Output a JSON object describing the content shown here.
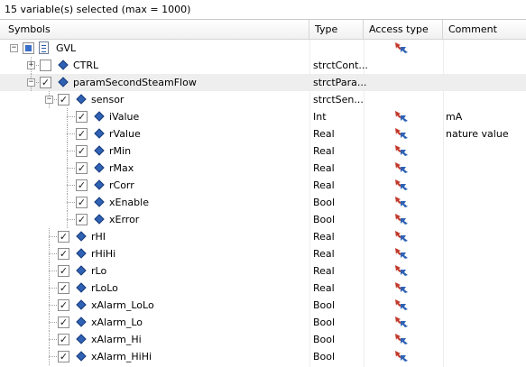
{
  "status": {
    "text": "15 variable(s) selected (max = 1000)"
  },
  "header": {
    "symbols": "Symbols",
    "type": "Type",
    "access_type": "Access type",
    "comment": "Comment"
  },
  "colors": {
    "checkbox_partial": "#3a6fc8",
    "var_icon": "#2f62b4",
    "row_highlight": "#eeeeee"
  },
  "rows": [
    {
      "label": "GVL",
      "type": "",
      "comment": "",
      "level": 0,
      "expander": "−",
      "check": "partial",
      "icon": "doc-icon",
      "access": true
    },
    {
      "label": "CTRL",
      "type": "strctCont...",
      "comment": "",
      "level": 1,
      "expander": "+",
      "check": "",
      "icon": "variable-icon",
      "access": false
    },
    {
      "label": "paramSecondSteamFlow",
      "type": "strctPara...",
      "comment": "",
      "level": 1,
      "expander": "−",
      "check": "✓",
      "icon": "variable-icon",
      "access": false,
      "highlight": true
    },
    {
      "label": "sensor",
      "type": "strctSen...",
      "comment": "",
      "level": 2,
      "expander": "−",
      "check": "✓",
      "icon": "variable-icon",
      "access": false
    },
    {
      "label": "iValue",
      "type": "Int",
      "comment": "mA",
      "level": 3,
      "expander": "",
      "check": "✓",
      "icon": "variable-icon",
      "access": true
    },
    {
      "label": "rValue",
      "type": "Real",
      "comment": "nature value",
      "level": 3,
      "expander": "",
      "check": "✓",
      "icon": "variable-icon",
      "access": true
    },
    {
      "label": "rMin",
      "type": "Real",
      "comment": "",
      "level": 3,
      "expander": "",
      "check": "✓",
      "icon": "variable-icon",
      "access": true
    },
    {
      "label": "rMax",
      "type": "Real",
      "comment": "",
      "level": 3,
      "expander": "",
      "check": "✓",
      "icon": "variable-icon",
      "access": true
    },
    {
      "label": "rCorr",
      "type": "Real",
      "comment": "",
      "level": 3,
      "expander": "",
      "check": "✓",
      "icon": "variable-icon",
      "access": true
    },
    {
      "label": "xEnable",
      "type": "Bool",
      "comment": "",
      "level": 3,
      "expander": "",
      "check": "✓",
      "icon": "variable-icon",
      "access": true
    },
    {
      "label": "xError",
      "type": "Bool",
      "comment": "",
      "level": 3,
      "expander": "",
      "check": "✓",
      "icon": "variable-icon",
      "access": true
    },
    {
      "label": "rHI",
      "type": "Real",
      "comment": "",
      "level": 2,
      "expander": "",
      "check": "✓",
      "icon": "variable-icon",
      "access": true
    },
    {
      "label": "rHiHi",
      "type": "Real",
      "comment": "",
      "level": 2,
      "expander": "",
      "check": "✓",
      "icon": "variable-icon",
      "access": true
    },
    {
      "label": "rLo",
      "type": "Real",
      "comment": "",
      "level": 2,
      "expander": "",
      "check": "✓",
      "icon": "variable-icon",
      "access": true
    },
    {
      "label": "rLoLo",
      "type": "Real",
      "comment": "",
      "level": 2,
      "expander": "",
      "check": "✓",
      "icon": "variable-icon",
      "access": true
    },
    {
      "label": "xAlarm_LoLo",
      "type": "Bool",
      "comment": "",
      "level": 2,
      "expander": "",
      "check": "✓",
      "icon": "variable-icon",
      "access": true
    },
    {
      "label": "xAlarm_Lo",
      "type": "Bool",
      "comment": "",
      "level": 2,
      "expander": "",
      "check": "✓",
      "icon": "variable-icon",
      "access": true
    },
    {
      "label": "xAlarm_Hi",
      "type": "Bool",
      "comment": "",
      "level": 2,
      "expander": "",
      "check": "✓",
      "icon": "variable-icon",
      "access": true
    },
    {
      "label": "xAlarm_HiHi",
      "type": "Bool",
      "comment": "",
      "level": 2,
      "expander": "",
      "check": "✓",
      "icon": "variable-icon",
      "access": true
    }
  ]
}
